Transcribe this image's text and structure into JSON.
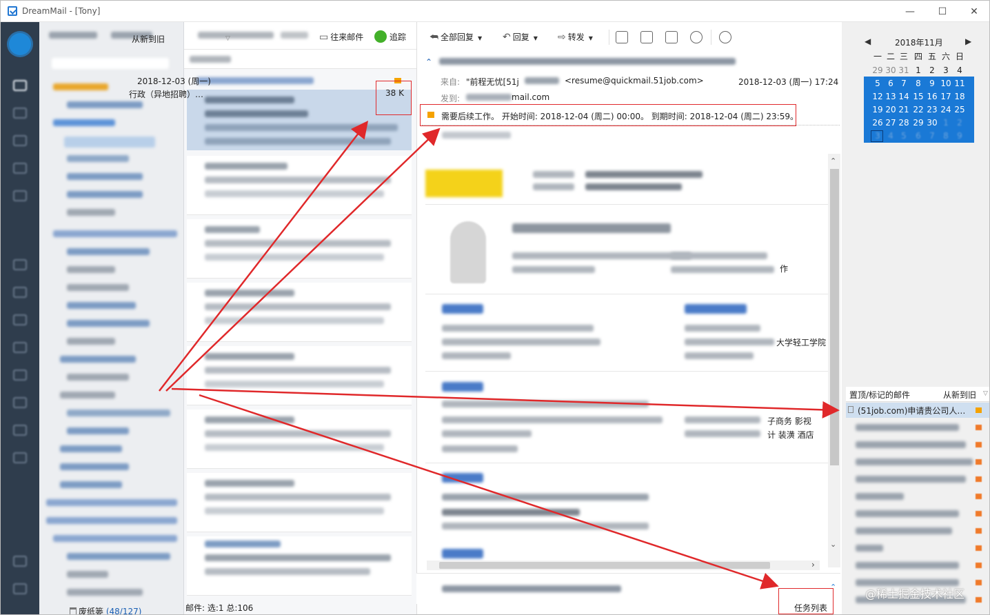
{
  "window": {
    "title": "DreamMail - [Tony]",
    "controls": [
      "—",
      "☐",
      "✕"
    ]
  },
  "folders": {
    "trash_label": "废纸篓",
    "trash_count": "(48/127)"
  },
  "message_list": {
    "sort_label": "从新到旧",
    "selected": {
      "date": "2018-12-03 (周一)",
      "subject_tail": "行政（异地招聘）…",
      "size": "38 K"
    },
    "status": "邮件: 选:1 总:106"
  },
  "reader": {
    "toolbar": {
      "reply_all": "全部回复",
      "reply": "回复",
      "forward": "转发"
    },
    "list_toolbar": {
      "incoming": "往来邮件",
      "track": "追踪"
    },
    "from_label": "来自:",
    "from_value": "\"前程无忧[51j",
    "from_email": "<resume@quickmail.51job.com>",
    "date": "2018-12-03 (周一) 17:24",
    "to_label": "发到:",
    "to_value": "mail.com",
    "flag_note": "需要后续工作。  开始时间: 2018-12-04 (周二) 00:00。  到期时间: 2018-12-04 (周二) 23:59。",
    "partial_texts": [
      "作",
      "大学轻工学院",
      "子商务  影视",
      "计 装潢  酒店"
    ]
  },
  "calendar": {
    "title": "2018年11月",
    "weekdays": [
      "一",
      "二",
      "三",
      "四",
      "五",
      "六",
      "日"
    ],
    "rows": [
      [
        "29",
        "30",
        "31",
        "1",
        "2",
        "3",
        "4"
      ],
      [
        "5",
        "6",
        "7",
        "8",
        "9",
        "10",
        "11"
      ],
      [
        "12",
        "13",
        "14",
        "15",
        "16",
        "17",
        "18"
      ],
      [
        "19",
        "20",
        "21",
        "22",
        "23",
        "24",
        "25"
      ],
      [
        "26",
        "27",
        "28",
        "29",
        "30",
        "1",
        "2"
      ],
      [
        "3",
        "4",
        "5",
        "6",
        "7",
        "8",
        "9"
      ]
    ]
  },
  "marked": {
    "title": "置顶/标记的邮件",
    "sort_label": "从新到旧",
    "first_item": "(51job.com)申请贵公司人…"
  },
  "task_list_label": "任务列表",
  "watermark": "@稀土掘金技术社区",
  "colors": {
    "accent": "#1a79d6",
    "flag": "#f5a200",
    "annotation": "#e0282a",
    "rail": "#2f3d4d"
  }
}
